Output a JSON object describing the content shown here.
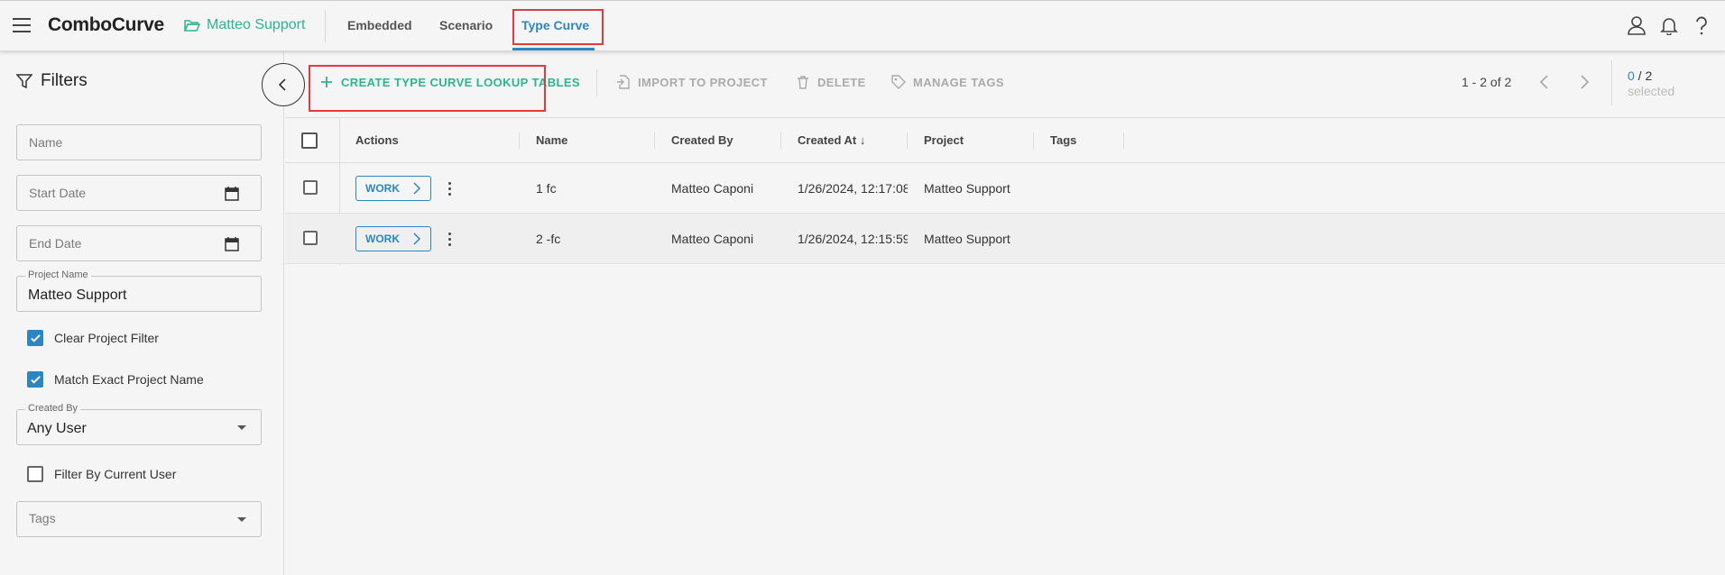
{
  "header": {
    "brand": "ComboCurve",
    "project": "Matteo Support",
    "tabs": [
      {
        "label": "Embedded",
        "active": false
      },
      {
        "label": "Scenario",
        "active": false
      },
      {
        "label": "Type Curve",
        "active": true
      }
    ],
    "icons": [
      "user-icon",
      "bell-icon",
      "help-icon"
    ]
  },
  "sidebar": {
    "title": "Filters",
    "name_placeholder": "Name",
    "start_date_placeholder": "Start Date",
    "end_date_placeholder": "End Date",
    "project_name_label": "Project Name",
    "project_name_value": "Matteo Support",
    "clear_project_filter": {
      "label": "Clear Project Filter",
      "checked": true
    },
    "match_exact_project_name": {
      "label": "Match Exact Project Name",
      "checked": true
    },
    "created_by_label": "Created By",
    "created_by_value": "Any User",
    "filter_by_current_user": {
      "label": "Filter By Current User",
      "checked": false
    },
    "tags_placeholder": "Tags"
  },
  "toolbar": {
    "create_label": "CREATE TYPE CURVE LOOKUP TABLES",
    "import_label": "IMPORT TO PROJECT",
    "delete_label": "DELETE",
    "manage_tags_label": "MANAGE TAGS",
    "pagination": "1 - 2 of 2",
    "selected_count": "0",
    "total_count": "2",
    "selected_label": "selected"
  },
  "table": {
    "columns": [
      "Actions",
      "Name",
      "Created By",
      "Created At",
      "Project",
      "Tags"
    ],
    "sort_indicator": "↓",
    "work_label": "WORK",
    "rows": [
      {
        "name": "1 fc",
        "created_by": "Matteo Caponi",
        "created_at": "1/26/2024, 12:17:08",
        "project": "Matteo Support",
        "tags": ""
      },
      {
        "name": "2 -fc",
        "created_by": "Matteo Caponi",
        "created_at": "1/26/2024, 12:15:59",
        "project": "Matteo Support",
        "tags": ""
      }
    ]
  },
  "colors": {
    "accent_green": "#2bb58f",
    "accent_blue": "#2e86c1",
    "highlight_red": "#e23b3b"
  }
}
